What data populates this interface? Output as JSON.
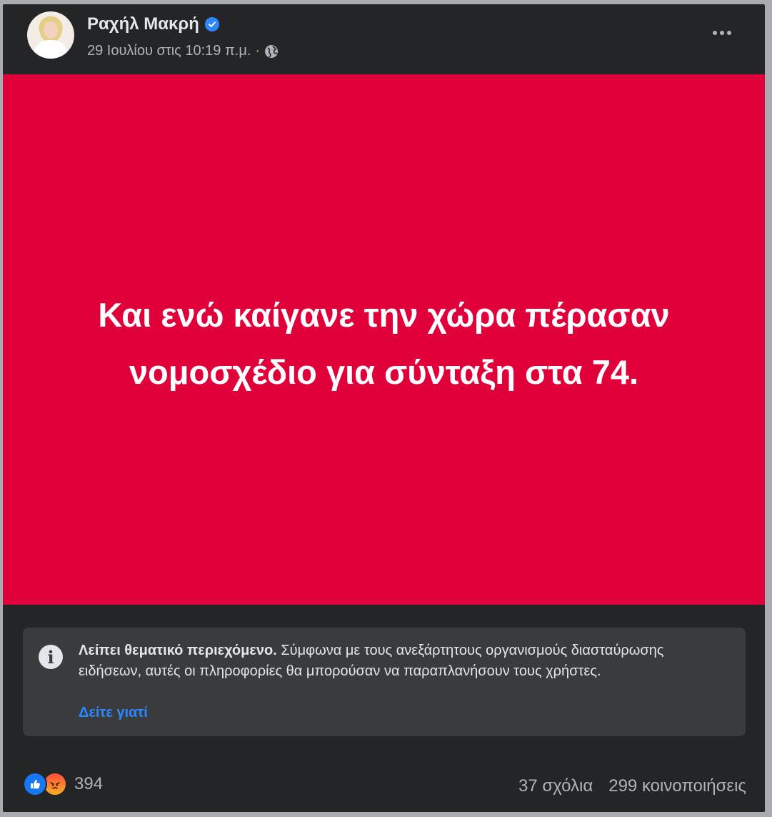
{
  "post": {
    "author": "Ραχήλ Μακρή",
    "timestamp": "29 Ιουλίου στις 10:19 π.μ.",
    "separator": "·",
    "media_text": "Και ενώ καίγανε την χώρα πέρασαν νομοσχέδιο για σύνταξη στα 74.",
    "media_background": "#e0003a"
  },
  "notice": {
    "title": "Λείπει θεματικό περιεχόμενο.",
    "body": "Σύμφωνα με τους ανεξάρτητους οργανισμούς διασταύρωσης ειδήσεων, αυτές οι πληροφορίες θα μπορούσαν να παραπλανήσουν τους χρήστες.",
    "link": "Δείτε γιατί"
  },
  "footer": {
    "reaction_count": "394",
    "comments": "37 σχόλια",
    "shares": "299 κοινοποιήσεις"
  },
  "icons": {
    "verified": "verified-badge-icon",
    "privacy": "globe-icon",
    "more": "more-options-icon",
    "info": "info-icon",
    "like": "like-reaction-icon",
    "angry": "angry-reaction-icon"
  }
}
